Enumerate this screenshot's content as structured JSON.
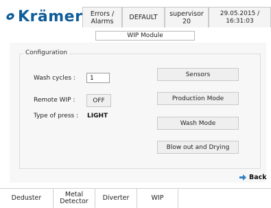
{
  "header": {
    "logo_text": "Krämer",
    "errors_alarms": "Errors / Alarms",
    "mode": "DEFAULT",
    "user": "supervisor 20",
    "datetime": "29.05.2015 / 16:31:03"
  },
  "screen_title": "WIP Module",
  "configuration": {
    "legend": "Configuration",
    "wash_cycles_label": "Wash cycles :",
    "wash_cycles_value": "1",
    "remote_wip_label": "Remote WIP :",
    "remote_wip_value": "OFF",
    "press_type_label": "Type of press :",
    "press_type_value": "LIGHT"
  },
  "actions": {
    "sensors": "Sensors",
    "production_mode": "Production Mode",
    "wash_mode": "Wash Mode",
    "blow_out": "Blow out and Drying"
  },
  "back_label": "Back",
  "bottom_tabs": [
    "Deduster",
    "Metal Detector",
    "Diverter",
    "WIP"
  ],
  "colors": {
    "brand": "#0f5d99",
    "accent_arrow": "#2f7fc1"
  }
}
